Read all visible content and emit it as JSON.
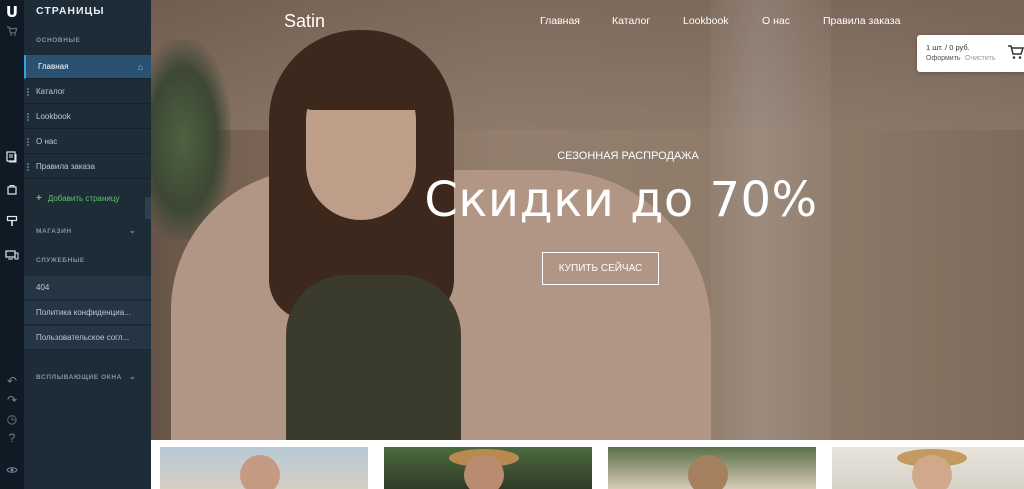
{
  "sidebar": {
    "title": "СТРАНИЦЫ",
    "main_section": "ОСНОВНЫЕ",
    "pages": [
      {
        "label": "Главная"
      },
      {
        "label": "Каталог"
      },
      {
        "label": "Lookbook"
      },
      {
        "label": "О нас"
      },
      {
        "label": "Правила заказа"
      }
    ],
    "add_page": "Добавить страницу",
    "shop_section": "МАГАЗИН",
    "service_section": "СЛУЖЕБНЫЕ",
    "service_pages": [
      {
        "label": "404"
      },
      {
        "label": "Политика конфиденциа..."
      },
      {
        "label": "Пользовательское согл..."
      }
    ],
    "popups_section": "ВСПЛЫВАЮЩИЕ ОКНА"
  },
  "site": {
    "brand": "Satin",
    "nav": [
      "Главная",
      "Каталог",
      "Lookbook",
      "О нас",
      "Правила заказа"
    ],
    "hero": {
      "subtitle": "СЕЗОННАЯ РАСПРОДАЖА",
      "title": "Скидки до 70%",
      "cta": "КУПИТЬ СЕЙЧАС"
    },
    "cart": {
      "summary": "1 шт. / 0 руб.",
      "checkout": "Оформить",
      "clear": "Очистить"
    }
  },
  "icons": {
    "logo": "U",
    "colors": {
      "accent": "#3aa0e0",
      "add": "#5dc86a",
      "sidebar_bg": "#1e2c38",
      "rail_bg": "#0f1a24"
    }
  }
}
